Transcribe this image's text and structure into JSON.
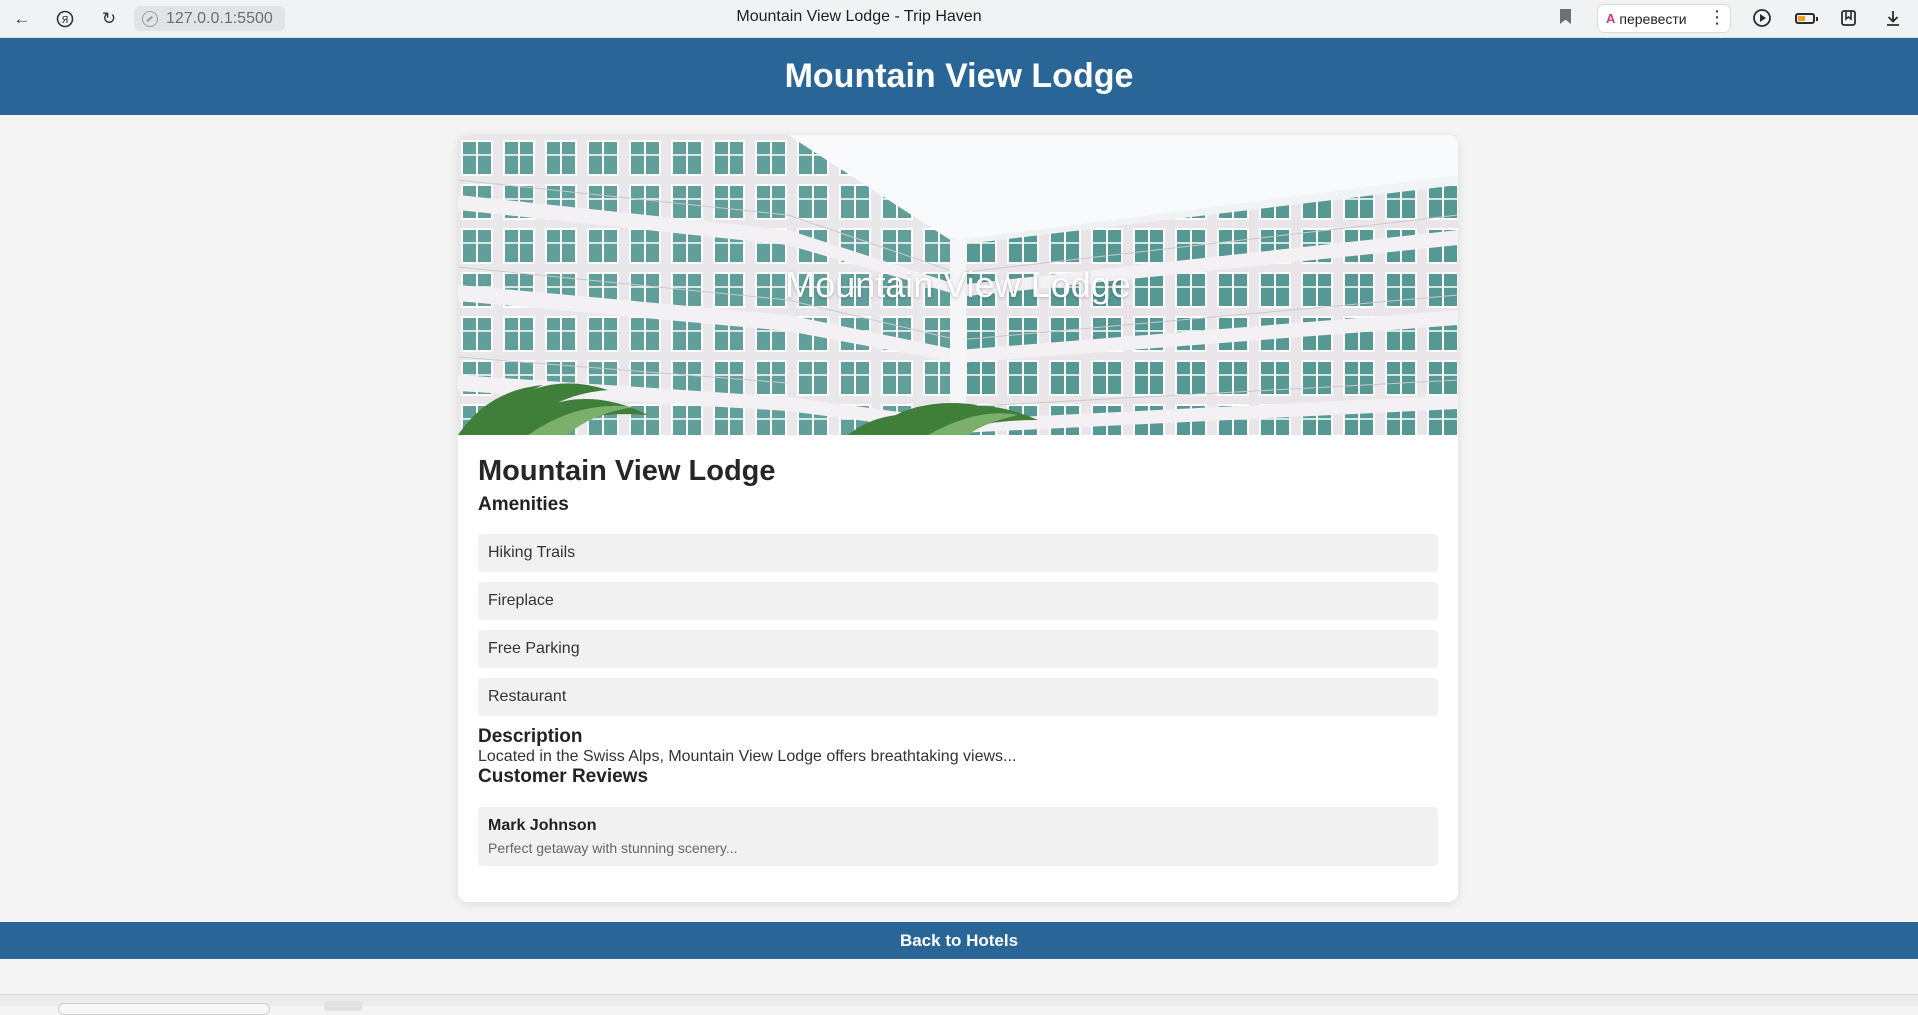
{
  "browser": {
    "url": "127.0.0.1:5500",
    "tab_title": "Mountain View Lodge - Trip Haven",
    "translate_label": "перевести",
    "translate_glyph": "A",
    "icons": [
      "back-arrow-icon",
      "yandex-icon",
      "reload-icon",
      "site-info-icon",
      "bookmark-icon",
      "translate-icon",
      "more-icon",
      "media-play-icon",
      "battery-icon",
      "collections-icon",
      "download-icon"
    ]
  },
  "header": {
    "title": "Mountain View Lodge"
  },
  "hotel": {
    "hero_caption": "Mountain View Lodge",
    "name": "Mountain View Lodge",
    "amenities_heading": "Amenities",
    "amenities": [
      "Hiking Trails",
      "Fireplace",
      "Free Parking",
      "Restaurant"
    ],
    "description_heading": "Description",
    "description": "Located in the Swiss Alps, Mountain View Lodge offers breathtaking views...",
    "reviews_heading": "Customer Reviews",
    "reviews": [
      {
        "author": "Mark Johnson",
        "text": "Perfect getaway with stunning scenery..."
      }
    ]
  },
  "footer": {
    "back_label": "Back to Hotels"
  },
  "colors": {
    "brand_blue": "#296597",
    "page_background": "#f4f4f4",
    "card_background": "#ffffff",
    "item_background": "#f1f1f1"
  }
}
